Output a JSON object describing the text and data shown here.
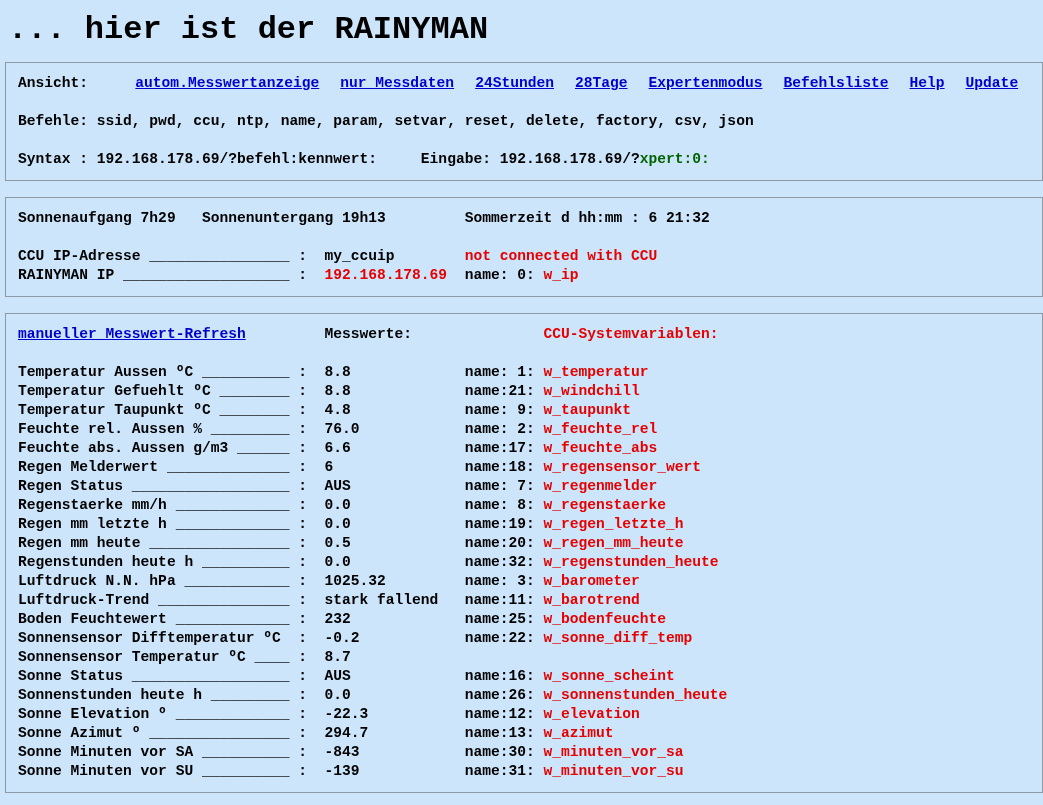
{
  "title": "... hier ist der RAINYMAN",
  "menu": {
    "label": "Ansicht:",
    "links": [
      "autom.Messwertanzeige",
      "nur Messdaten",
      "24Stunden",
      "28Tage",
      "Expertenmodus",
      "Befehlsliste",
      "Help",
      "Update"
    ],
    "commands": "Befehle: ssid, pwd, ccu, ntp, name, param, setvar, reset, delete, factory, csv, json",
    "syntax": "Syntax : 192.168.178.69/?befehl:kennwert:",
    "input_label": "Eingabe: 192.168.178.69/?",
    "input_value": "xpert:0:"
  },
  "status": {
    "sunrise": "Sonnenaufgang 7h29",
    "sunset": "Sonnenuntergang 19h13",
    "dst": "Sommerzeit d hh:mm : 6 21:32",
    "rows": [
      {
        "label": "CCU IP-Adresse ________________ :",
        "value": "my_ccuip",
        "value_alert": false,
        "note": "not connected with CCU"
      },
      {
        "label": "RAINYMAN IP ___________________ :",
        "value": "192.168.178.69",
        "value_alert": true,
        "index": "name: 0:",
        "variable": "w_ip"
      }
    ]
  },
  "measurements": {
    "refresh_link": "manueller Messwert-Refresh",
    "values_heading": "Messwerte:",
    "variables_heading": "CCU-Systemvariablen:",
    "rows": [
      {
        "label": "Temperatur Aussen ºC __________ :",
        "value": "8.8",
        "index": "name: 1:",
        "variable": "w_temperatur"
      },
      {
        "label": "Temperatur Gefuehlt ºC ________ :",
        "value": "8.8",
        "index": "name:21:",
        "variable": "w_windchill"
      },
      {
        "label": "Temperatur Taupunkt ºC ________ :",
        "value": "4.8",
        "index": "name: 9:",
        "variable": "w_taupunkt"
      },
      {
        "label": "Feuchte rel. Aussen % _________ :",
        "value": "76.0",
        "index": "name: 2:",
        "variable": "w_feuchte_rel"
      },
      {
        "label": "Feuchte abs. Aussen g/m3 ______ :",
        "value": "6.6",
        "index": "name:17:",
        "variable": "w_feuchte_abs"
      },
      {
        "label": "Regen Melderwert ______________ :",
        "value": "6",
        "index": "name:18:",
        "variable": "w_regensensor_wert"
      },
      {
        "label": "Regen Status __________________ :",
        "value": "AUS",
        "index": "name: 7:",
        "variable": "w_regenmelder"
      },
      {
        "label": "Regenstaerke mm/h _____________ :",
        "value": "0.0",
        "index": "name: 8:",
        "variable": "w_regenstaerke"
      },
      {
        "label": "Regen mm letzte h _____________ :",
        "value": "0.0",
        "index": "name:19:",
        "variable": "w_regen_letzte_h"
      },
      {
        "label": "Regen mm heute ________________ :",
        "value": "0.5",
        "index": "name:20:",
        "variable": "w_regen_mm_heute"
      },
      {
        "label": "Regenstunden heute h __________ :",
        "value": "0.0",
        "index": "name:32:",
        "variable": "w_regenstunden_heute"
      },
      {
        "label": "Luftdruck N.N. hPa ____________ :",
        "value": "1025.32",
        "index": "name: 3:",
        "variable": "w_barometer"
      },
      {
        "label": "Luftdruck-Trend _______________ :",
        "value": "stark fallend",
        "index": "name:11:",
        "variable": "w_barotrend"
      },
      {
        "label": "Boden Feuchtewert _____________ :",
        "value": "232",
        "index": "name:25:",
        "variable": "w_bodenfeuchte"
      },
      {
        "label": "Sonnensensor Difftemperatur ºC  :",
        "value": "-0.2",
        "index": "name:22:",
        "variable": "w_sonne_diff_temp"
      },
      {
        "label": "Sonnensensor Temperatur ºC ____ :",
        "value": "8.7"
      },
      {
        "label": "Sonne Status __________________ :",
        "value": "AUS",
        "index": "name:16:",
        "variable": "w_sonne_scheint"
      },
      {
        "label": "Sonnenstunden heute h _________ :",
        "value": "0.0",
        "index": "name:26:",
        "variable": "w_sonnenstunden_heute"
      },
      {
        "label": "Sonne Elevation º _____________ :",
        "value": "-22.3",
        "index": "name:12:",
        "variable": "w_elevation"
      },
      {
        "label": "Sonne Azimut º ________________ :",
        "value": "294.7",
        "index": "name:13:",
        "variable": "w_azimut"
      },
      {
        "label": "Sonne Minuten vor SA __________ :",
        "value": "-843",
        "index": "name:30:",
        "variable": "w_minuten_vor_sa"
      },
      {
        "label": "Sonne Minuten vor SU __________ :",
        "value": "-139",
        "index": "name:31:",
        "variable": "w_minuten_vor_su"
      }
    ]
  }
}
